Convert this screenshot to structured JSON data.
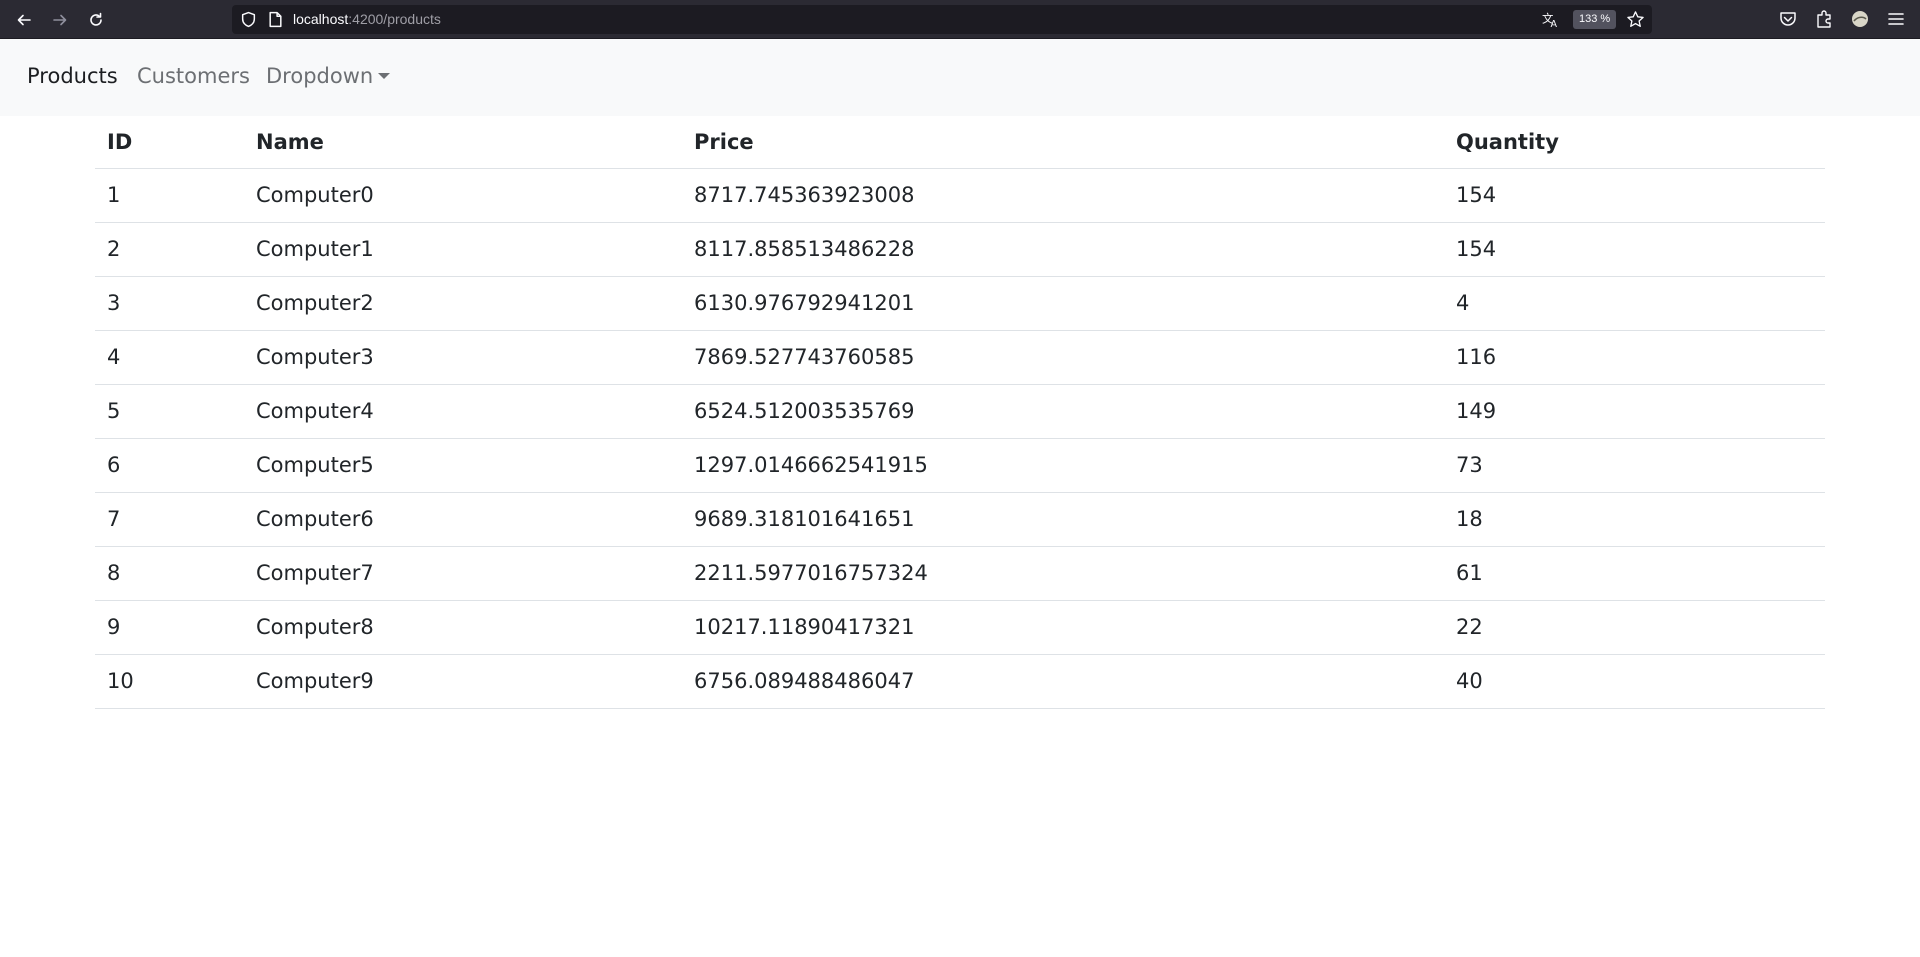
{
  "browser": {
    "url_host": "localhost",
    "url_path": ":4200/products",
    "zoom": "133 %"
  },
  "navbar": {
    "links": [
      {
        "label": "Products"
      },
      {
        "label": "Customers"
      },
      {
        "label": "Dropdown"
      }
    ]
  },
  "table": {
    "columns": [
      "ID",
      "Name",
      "Price",
      "Quantity"
    ],
    "rows": [
      [
        "1",
        "Computer0",
        "8717.745363923008",
        "154"
      ],
      [
        "2",
        "Computer1",
        "8117.858513486228",
        "154"
      ],
      [
        "3",
        "Computer2",
        "6130.976792941201",
        "4"
      ],
      [
        "4",
        "Computer3",
        "7869.527743760585",
        "116"
      ],
      [
        "5",
        "Computer4",
        "6524.512003535769",
        "149"
      ],
      [
        "6",
        "Computer5",
        "1297.0146662541915",
        "73"
      ],
      [
        "7",
        "Computer6",
        "9689.318101641651",
        "18"
      ],
      [
        "8",
        "Computer7",
        "2211.5977016757324",
        "61"
      ],
      [
        "9",
        "Computer8",
        "10217.11890417321",
        "22"
      ],
      [
        "10",
        "Computer9",
        "6756.089488486047",
        "40"
      ]
    ]
  }
}
